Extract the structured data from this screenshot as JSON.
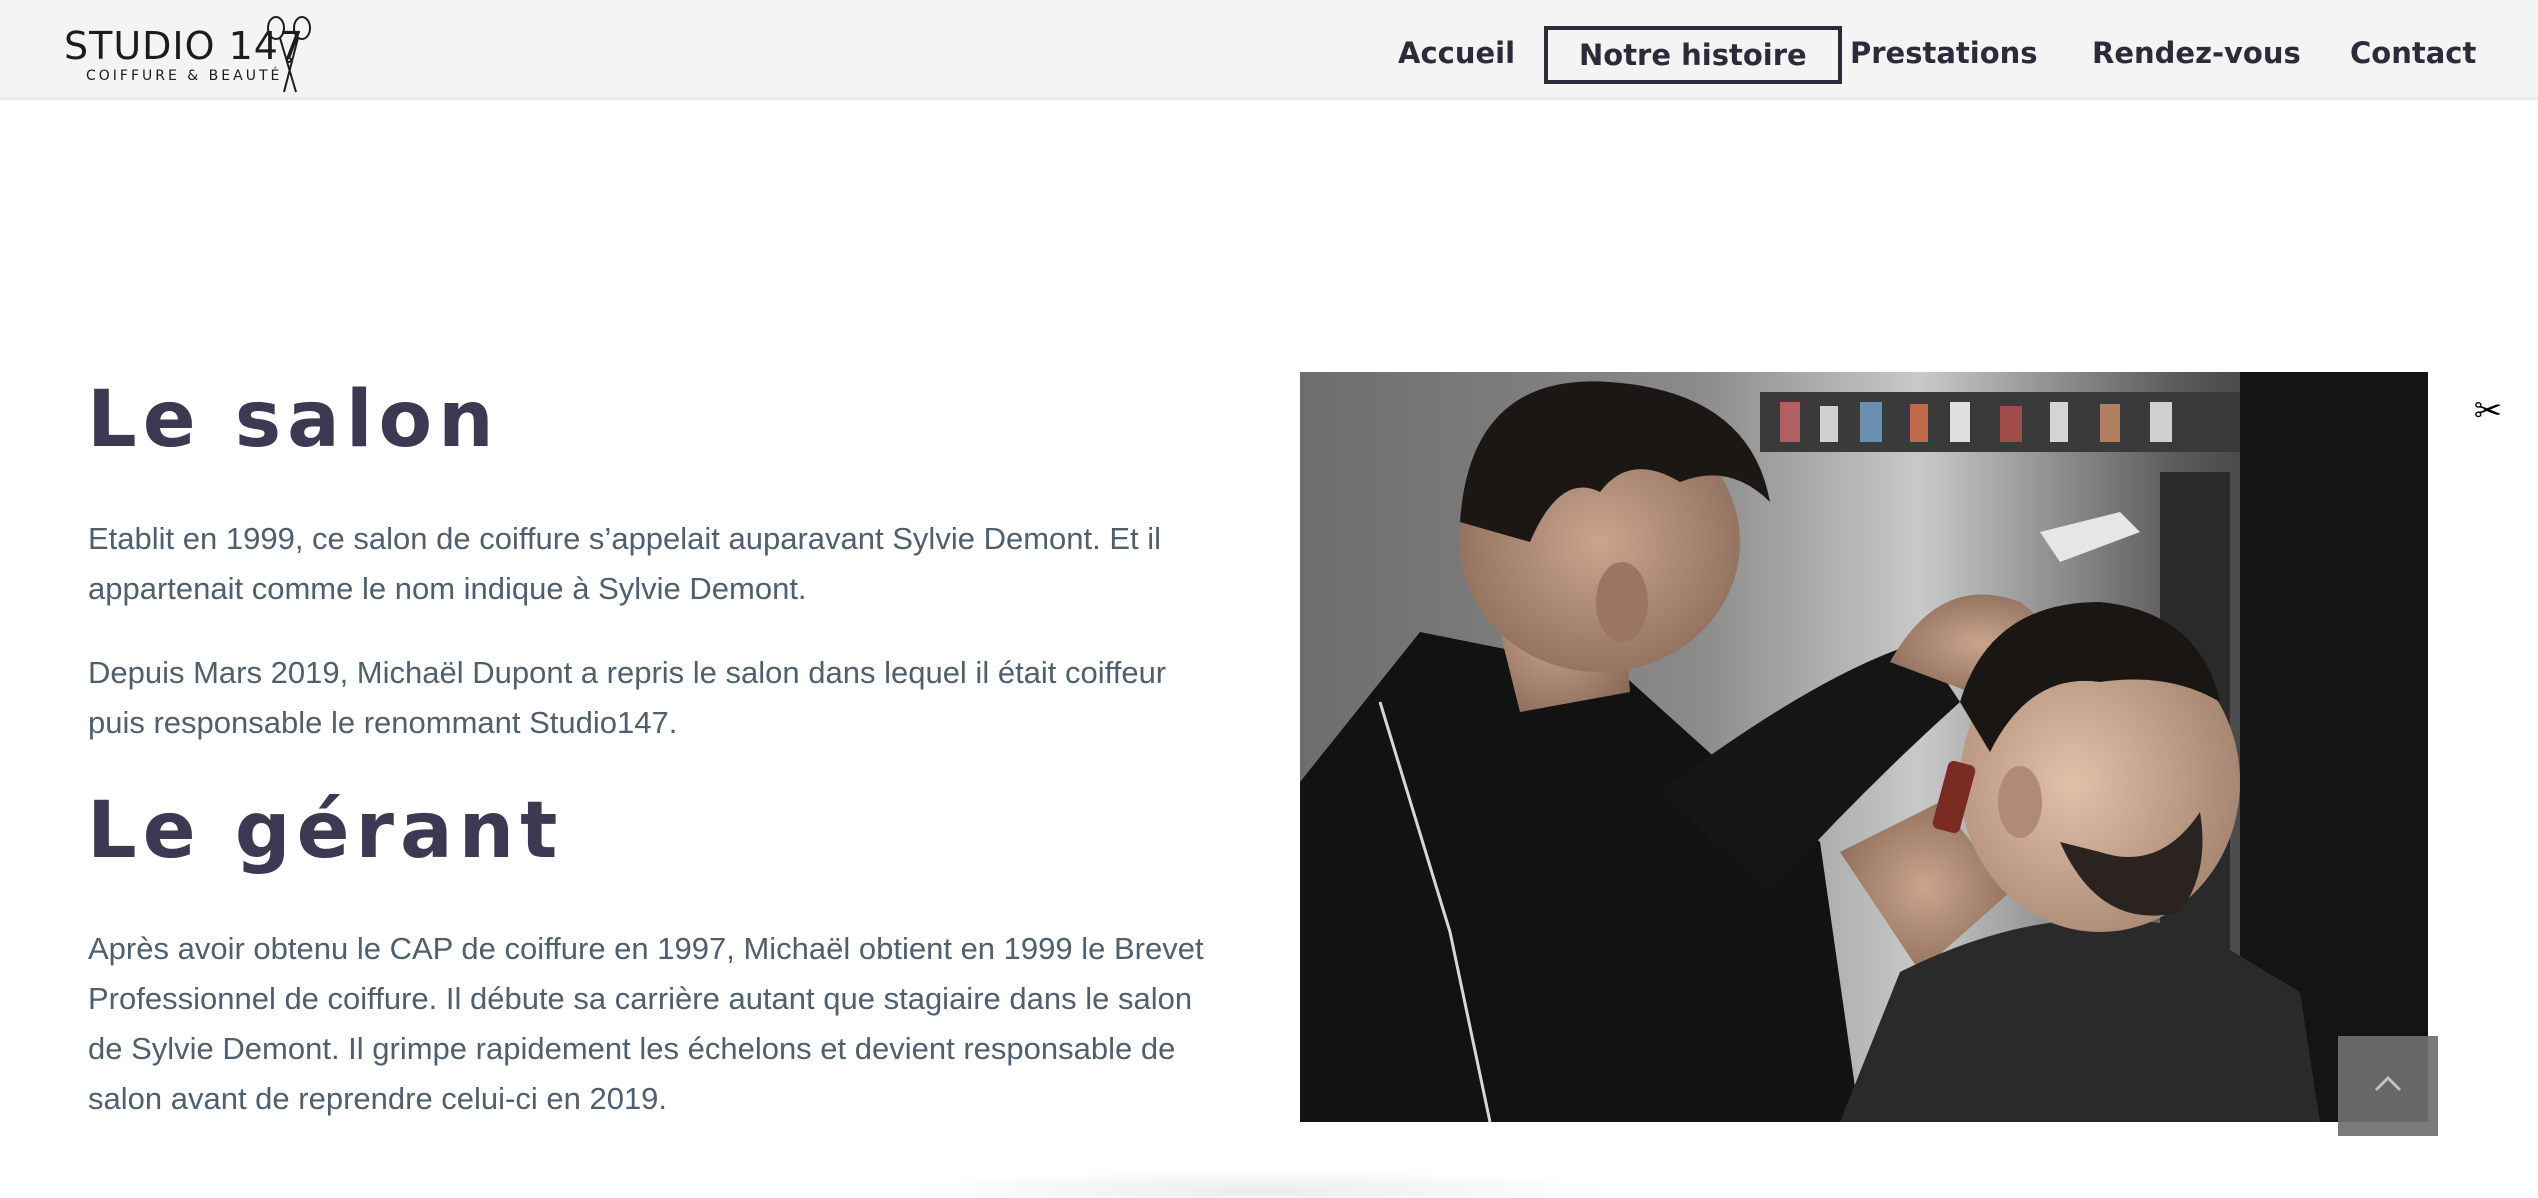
{
  "header": {
    "logo": {
      "title": "STUDIO 147",
      "subtitle": "COIFFURE & BEAUTÉ",
      "icon": "scissors-icon"
    },
    "nav": [
      {
        "label": "Accueil",
        "active": false
      },
      {
        "label": "Notre histoire",
        "active": true
      },
      {
        "label": "Prestations",
        "active": false
      },
      {
        "label": "Rendez-vous",
        "active": false
      },
      {
        "label": "Contact",
        "active": false
      }
    ]
  },
  "main": {
    "salon": {
      "title": "Le salon",
      "paragraphs": [
        "Etablit en 1999, ce salon de coiffure s’appelait auparavant Sylvie Demont. Et il appartenait comme le nom indique à Sylvie Demont.",
        "Depuis Mars 2019, Michaël Dupont a repris le salon dans lequel il était coiffeur puis responsable le renommant Studio147."
      ]
    },
    "gerant": {
      "title": "Le gérant",
      "paragraphs": [
        "Après avoir obtenu le CAP de coiffure en 1997, Michaël obtient en 1999 le Brevet Professionnel de coiffure. Il débute sa carrière autant que stagiaire dans le salon de Sylvie Demont. Il grimpe rapidement les échelons et devient responsable de salon avant de reprendre celui-ci en 2019."
      ]
    },
    "photo": {
      "icon": "barber-photo"
    }
  },
  "floating": {
    "scissor_icon": "✂",
    "scroll_top_icon": "chevron-up-icon"
  },
  "colors": {
    "heading": "#3b3a52",
    "text": "#4f5f6e",
    "nav_text": "#2d2b3a",
    "header_bg": "#f3f4f4"
  }
}
